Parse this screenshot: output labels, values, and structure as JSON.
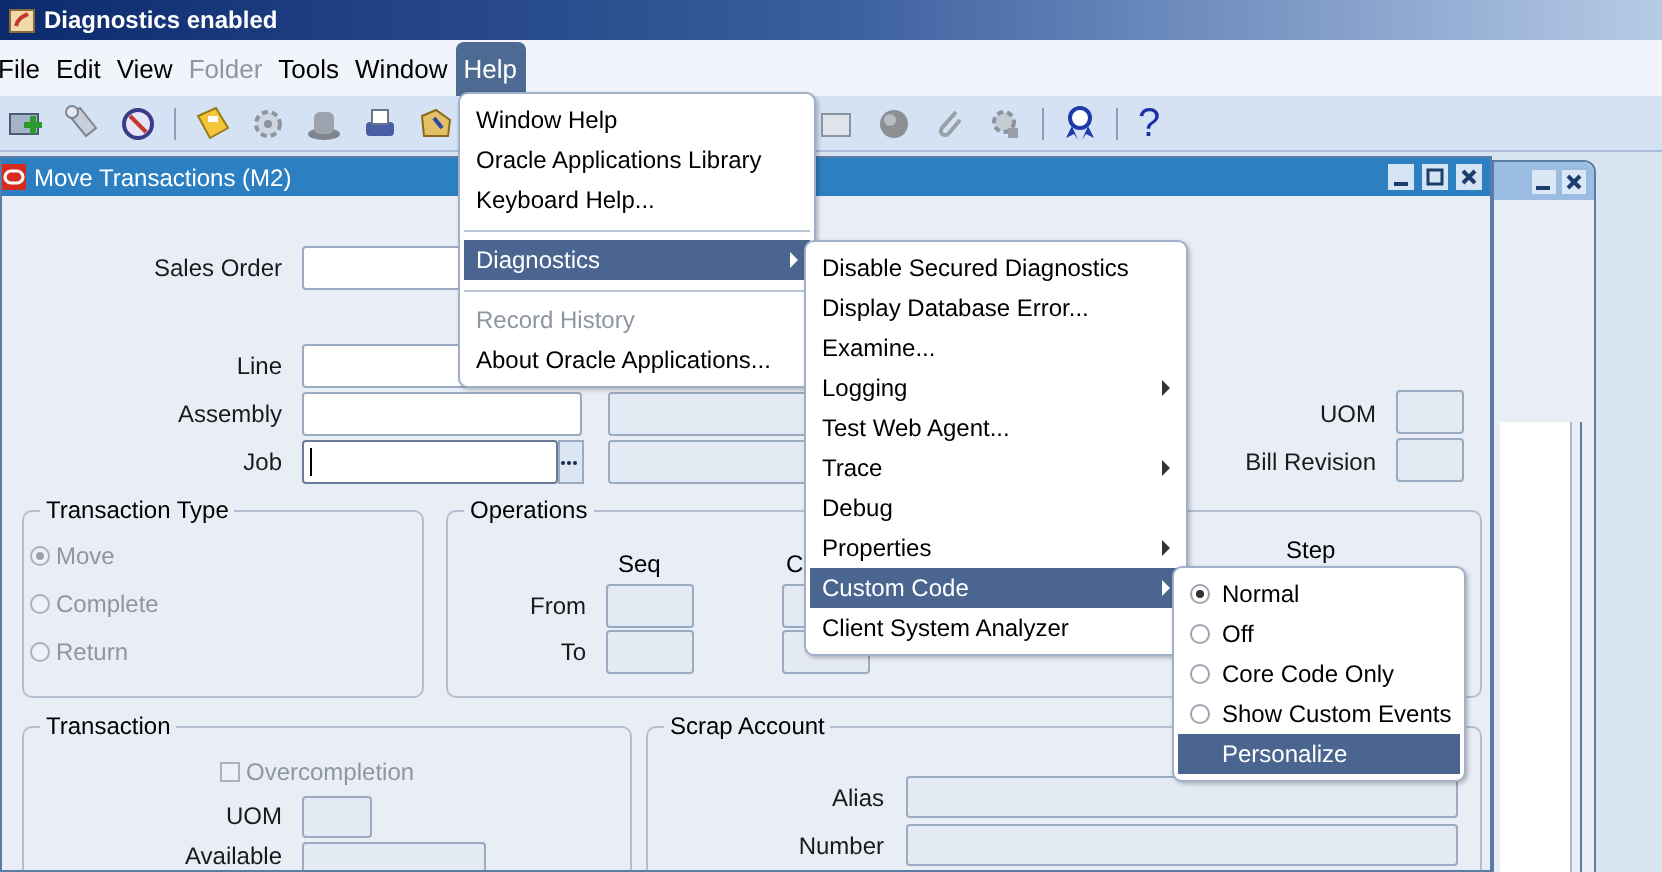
{
  "window": {
    "title": "Diagnostics enabled"
  },
  "menubar": [
    {
      "label": "File",
      "disabled": false,
      "selected": false
    },
    {
      "label": "Edit",
      "disabled": false,
      "selected": false
    },
    {
      "label": "View",
      "disabled": false,
      "selected": false
    },
    {
      "label": "Folder",
      "disabled": true,
      "selected": false
    },
    {
      "label": "Tools",
      "disabled": false,
      "selected": false
    },
    {
      "label": "Window",
      "disabled": false,
      "selected": false
    },
    {
      "label": "Help",
      "disabled": false,
      "selected": true
    }
  ],
  "toolbar": {
    "help_glyph": "?"
  },
  "form": {
    "title": "Move Transactions (M2)",
    "fields": [
      {
        "label": "Sales Order",
        "editable": true,
        "focused": false
      },
      {
        "label": "Line",
        "editable": true,
        "focused": false
      },
      {
        "label": "Assembly",
        "editable": true,
        "focused": false
      },
      {
        "label": "Job",
        "editable": true,
        "focused": true
      },
      {
        "label": "UOM",
        "editable": false,
        "focused": false
      },
      {
        "label": "Bill Revision",
        "editable": false,
        "focused": false
      }
    ],
    "transaction_type": {
      "title": "Transaction Type",
      "options": [
        {
          "label": "Move",
          "selected": true
        },
        {
          "label": "Complete",
          "selected": false
        },
        {
          "label": "Return",
          "selected": false
        }
      ]
    },
    "operations": {
      "title": "Operations",
      "column_1": "Seq",
      "column_2": "C",
      "column_3": "Step",
      "rows": [
        "From",
        "To"
      ]
    },
    "transaction": {
      "title": "Transaction",
      "overcompletion": {
        "label": "Overcompletion",
        "checked": false
      },
      "fields": [
        "UOM",
        "Available"
      ]
    },
    "scrap_account": {
      "title": "Scrap Account",
      "fields": [
        "Alias",
        "Number"
      ]
    }
  },
  "help_menu": [
    {
      "kind": "item",
      "label": "Window Help",
      "disabled": false,
      "selected": false,
      "submenu": false
    },
    {
      "kind": "item",
      "label": "Oracle Applications Library",
      "disabled": false,
      "selected": false,
      "submenu": false
    },
    {
      "kind": "item",
      "label": "Keyboard Help...",
      "disabled": false,
      "selected": false,
      "submenu": false
    },
    {
      "kind": "separator"
    },
    {
      "kind": "item",
      "label": "Diagnostics",
      "disabled": false,
      "selected": true,
      "submenu": true
    },
    {
      "kind": "separator"
    },
    {
      "kind": "item",
      "label": "Record History",
      "disabled": true,
      "selected": false,
      "submenu": false
    },
    {
      "kind": "item",
      "label": "About Oracle Applications...",
      "disabled": false,
      "selected": false,
      "submenu": false
    }
  ],
  "diagnostics_menu": [
    {
      "kind": "item",
      "label": "Disable Secured Diagnostics",
      "disabled": false,
      "selected": false,
      "submenu": false
    },
    {
      "kind": "item",
      "label": "Display Database Error...",
      "disabled": false,
      "selected": false,
      "submenu": false
    },
    {
      "kind": "item",
      "label": "Examine...",
      "disabled": false,
      "selected": false,
      "submenu": false
    },
    {
      "kind": "item",
      "label": "Logging",
      "disabled": false,
      "selected": false,
      "submenu": true
    },
    {
      "kind": "item",
      "label": "Test Web Agent...",
      "disabled": false,
      "selected": false,
      "submenu": false
    },
    {
      "kind": "item",
      "label": "Trace",
      "disabled": false,
      "selected": false,
      "submenu": true
    },
    {
      "kind": "item",
      "label": "Debug",
      "disabled": false,
      "selected": false,
      "submenu": false
    },
    {
      "kind": "item",
      "label": "Properties",
      "disabled": false,
      "selected": false,
      "submenu": true
    },
    {
      "kind": "item",
      "label": "Custom Code",
      "disabled": false,
      "selected": true,
      "submenu": true
    },
    {
      "kind": "item",
      "label": "Client System Analyzer",
      "disabled": false,
      "selected": false,
      "submenu": false
    }
  ],
  "custom_code_menu": [
    {
      "kind": "radio",
      "label": "Normal",
      "checked": true,
      "selected": false
    },
    {
      "kind": "radio",
      "label": "Off",
      "checked": false,
      "selected": false
    },
    {
      "kind": "radio",
      "label": "Core Code Only",
      "checked": false,
      "selected": false
    },
    {
      "kind": "radio",
      "label": "Show Custom Events",
      "checked": false,
      "selected": false
    },
    {
      "kind": "item",
      "label": "Personalize",
      "selected": true
    }
  ]
}
